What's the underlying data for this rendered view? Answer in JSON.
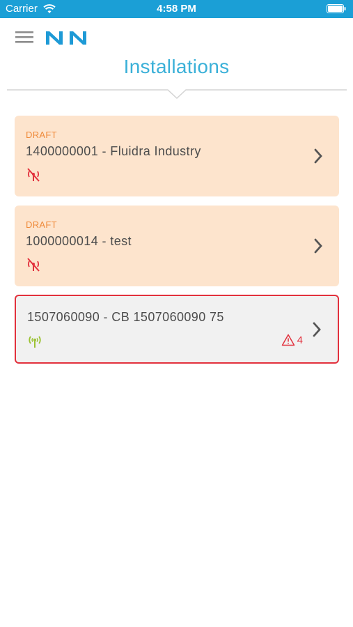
{
  "status_bar": {
    "carrier": "Carrier",
    "time": "4:58 PM"
  },
  "header": {
    "logo_icon": "nn-logo",
    "menu_icon": "hamburger-menu-icon",
    "title": "Installations"
  },
  "installations": [
    {
      "status": "DRAFT",
      "title": "1400000001 - Fluidra Industry",
      "signal_icon": "no-signal-icon",
      "signal_color": "#e2313d"
    },
    {
      "status": "DRAFT",
      "title": "1000000014 - test",
      "signal_icon": "no-signal-icon",
      "signal_color": "#e2313d"
    },
    {
      "status": "",
      "title": "1507060090 - CB 1507060090 75",
      "signal_icon": "signal-icon",
      "signal_color": "#9bc233",
      "alert_icon": "warning-icon",
      "alert_count": "4"
    }
  ],
  "colors": {
    "status_bar": "#1b9fd6",
    "title": "#3ab0d8",
    "draft_card": "#fde4cd",
    "draft_label": "#ef8a3a",
    "active_card": "#f1f1f1",
    "alert": "#e2313d"
  }
}
